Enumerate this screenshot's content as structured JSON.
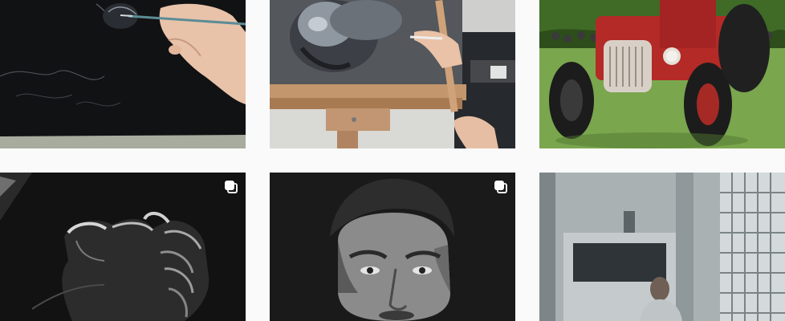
{
  "feed": {
    "posts": [
      {
        "id": "post-1",
        "subject": "drawing-on-black-paper",
        "multiple": false
      },
      {
        "id": "post-2",
        "subject": "portrait-on-easel",
        "multiple": false
      },
      {
        "id": "post-3",
        "subject": "red-tractor-painting",
        "multiple": false
      },
      {
        "id": "post-4",
        "subject": "hands-drawing",
        "multiple": true
      },
      {
        "id": "post-5",
        "subject": "male-portrait",
        "multiple": true
      },
      {
        "id": "post-6",
        "subject": "studio-room-photo",
        "multiple": false
      }
    ],
    "colors": {
      "background": "#fafafa",
      "icon": "#ffffff"
    },
    "icons": {
      "multiple_posts": "multiple-images-icon"
    }
  }
}
